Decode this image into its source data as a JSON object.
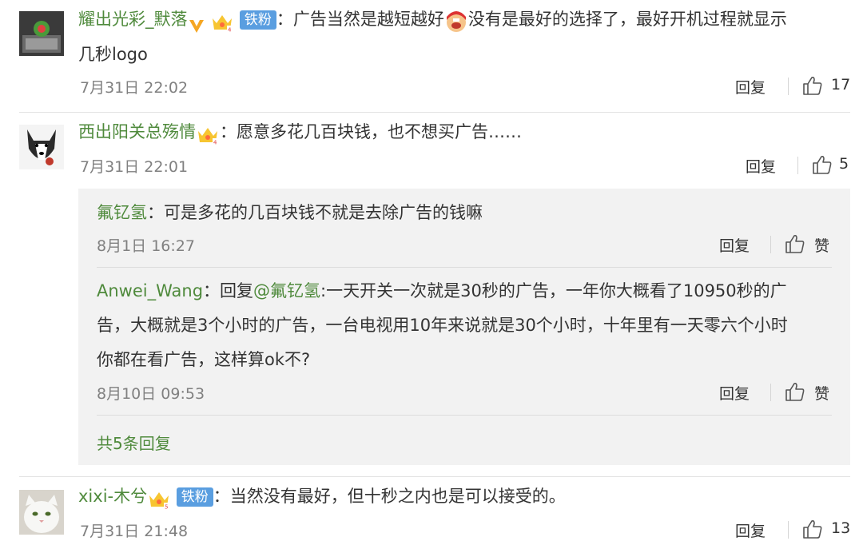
{
  "comments": [
    {
      "username": "耀出光彩_默落",
      "fan_badge": "铁粉",
      "line1_a": "：广告当然是越短越好",
      "line1_b": "没有是最好的选择了，最好开机过程就显示",
      "line2": "几秒logo",
      "date": "7月31日 22:02",
      "reply_label": "回复",
      "likes": "17"
    },
    {
      "username": "西出阳关总殇情",
      "text": "：愿意多花几百块钱，也不想买广告……",
      "date": "7月31日 22:01",
      "reply_label": "回复",
      "likes": "5"
    },
    {
      "username": "xixi-木兮",
      "fan_badge": "铁粉",
      "text": "：当然没有最好，但十秒之内也是可以接受的。",
      "date": "7月31日 21:48",
      "reply_label": "回复",
      "likes": "13"
    }
  ],
  "replies": [
    {
      "username": "氟钇氢",
      "text": "：可是多花的几百块钱不就是去除广告的钱嘛",
      "date": "8月1日 16:27",
      "reply_label": "回复",
      "like_label": "赞"
    },
    {
      "username": "Anwei_Wang",
      "prefix": "：回复",
      "mention": "@氟钇氢",
      "line1": ":一天开关一次就是30秒的广告，一年你大概看了10950秒的广",
      "line2": "告，大概就是3个小时的广告，一台电视用10年来说就是30个小时，十年里有一天零六个小时",
      "line3": "你都在看广告，这样算ok不?",
      "date": "8月10日 09:53",
      "reply_label": "回复",
      "like_label": "赞"
    }
  ],
  "more_replies": "共5条回复",
  "colors": {
    "username": "#4f8a3c",
    "reply_bg": "#f2f2f2",
    "fan_badge": "#5a9ee0",
    "date": "#808080"
  }
}
